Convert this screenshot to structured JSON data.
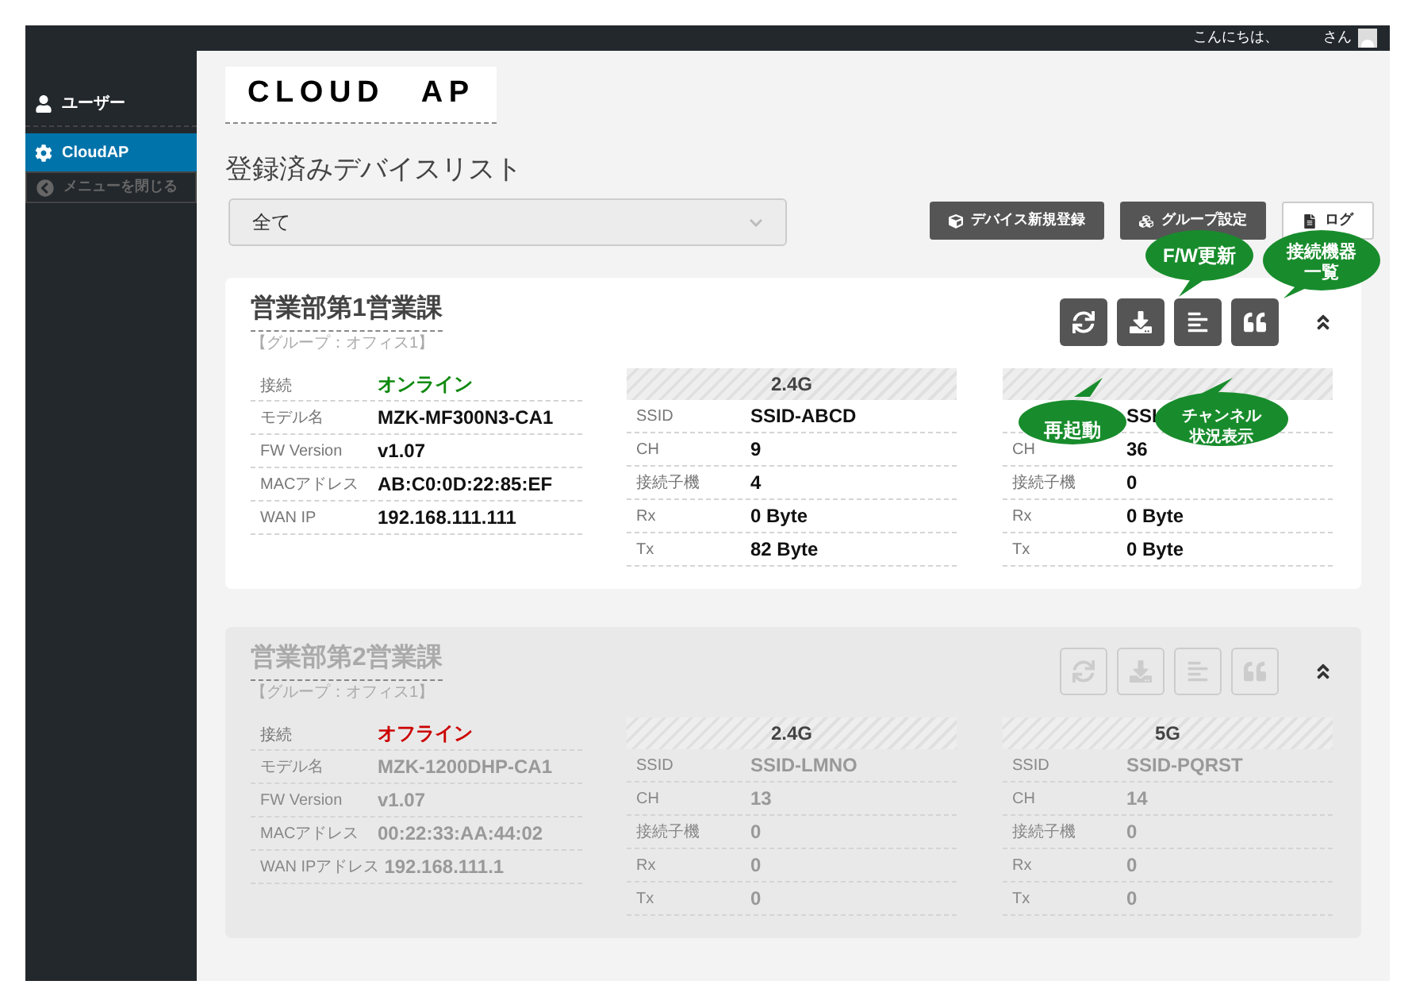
{
  "topbar": {
    "greeting": "こんにちは、",
    "suffix": "さん"
  },
  "sidebar": {
    "items": [
      {
        "kind": "user",
        "label": "ユーザー",
        "selected": false,
        "disabled": false
      },
      {
        "kind": "settings",
        "label": "CloudAP",
        "selected": true,
        "disabled": false
      },
      {
        "kind": "collapse",
        "label": "メニューを閉じる",
        "selected": false,
        "disabled": true
      }
    ]
  },
  "logo": "CLOUD　AP",
  "heading": "登録済みデバイスリスト",
  "filter": {
    "value": "全て"
  },
  "buttons": [
    {
      "kind": "register",
      "label": "デバイス新規登録"
    },
    {
      "kind": "group",
      "label": "グループ設定"
    },
    {
      "kind": "log",
      "label": "ログ"
    }
  ],
  "devices": [
    {
      "name": "営業部第1営業課",
      "group": "【グループ：オフィス1】",
      "disabled": false,
      "status": {
        "label": "接続",
        "value": "オンライン",
        "color": "#0f8a0f"
      },
      "info": [
        {
          "label": "モデル名",
          "value": "MZK-MF300N3-CA1"
        },
        {
          "label": "FW Version",
          "value": "v1.07"
        },
        {
          "label": "MACアドレス",
          "value": "AB:C0:0D:22:85:EF"
        },
        {
          "label": "WAN IP",
          "value": "192.168.111.111"
        }
      ],
      "bands": [
        {
          "header": "2.4G",
          "rows": [
            {
              "label": "SSID",
              "value": "SSID-ABCD"
            },
            {
              "label": "CH",
              "value": "9"
            },
            {
              "label": "接続子機",
              "value": "4"
            },
            {
              "label": "Rx",
              "value": "0 Byte"
            },
            {
              "label": "Tx",
              "value": "82 Byte"
            }
          ]
        },
        {
          "rows": [
            {
              "value": "SSI"
            },
            {
              "label": "CH",
              "value": "36"
            },
            {
              "label": "接続子機",
              "value": "0"
            },
            {
              "label": "Rx",
              "value": "0 Byte"
            },
            {
              "label": "Tx",
              "value": "0 Byte"
            }
          ]
        }
      ]
    },
    {
      "name": "営業部第2営業課",
      "group": "【グループ：オフィス1】",
      "disabled": true,
      "status": {
        "label": "接続",
        "value": "オフライン",
        "color": "#cc0000"
      },
      "info": [
        {
          "label": "モデル名",
          "value": "MZK-1200DHP-CA1"
        },
        {
          "label": "FW Version",
          "value": "v1.07"
        },
        {
          "label": "MACアドレス",
          "value": "00:22:33:AA:44:02"
        },
        {
          "label": "WAN IPアドレス",
          "value": "192.168.111.1"
        }
      ],
      "bands": [
        {
          "header": "2.4G",
          "rows": [
            {
              "label": "SSID",
              "value": "SSID-LMNO"
            },
            {
              "label": "CH",
              "value": "13"
            },
            {
              "label": "接続子機",
              "value": "0"
            },
            {
              "label": "Rx",
              "value": "0"
            },
            {
              "label": "Tx",
              "value": "0"
            }
          ]
        },
        {
          "header": "5G",
          "rows": [
            {
              "label": "SSID",
              "value": "SSID-PQRST"
            },
            {
              "label": "CH",
              "value": "14"
            },
            {
              "label": "接続子機",
              "value": "0"
            },
            {
              "label": "Rx",
              "value": "0"
            },
            {
              "label": "Tx",
              "value": "0"
            }
          ]
        }
      ]
    }
  ],
  "callouts": [
    {
      "lines": [
        "F/W更新"
      ]
    },
    {
      "lines": [
        "接続機器",
        "一覧"
      ]
    },
    {
      "lines": [
        "再起動"
      ]
    },
    {
      "lines": [
        "チャンネル",
        "状況表示"
      ]
    }
  ]
}
